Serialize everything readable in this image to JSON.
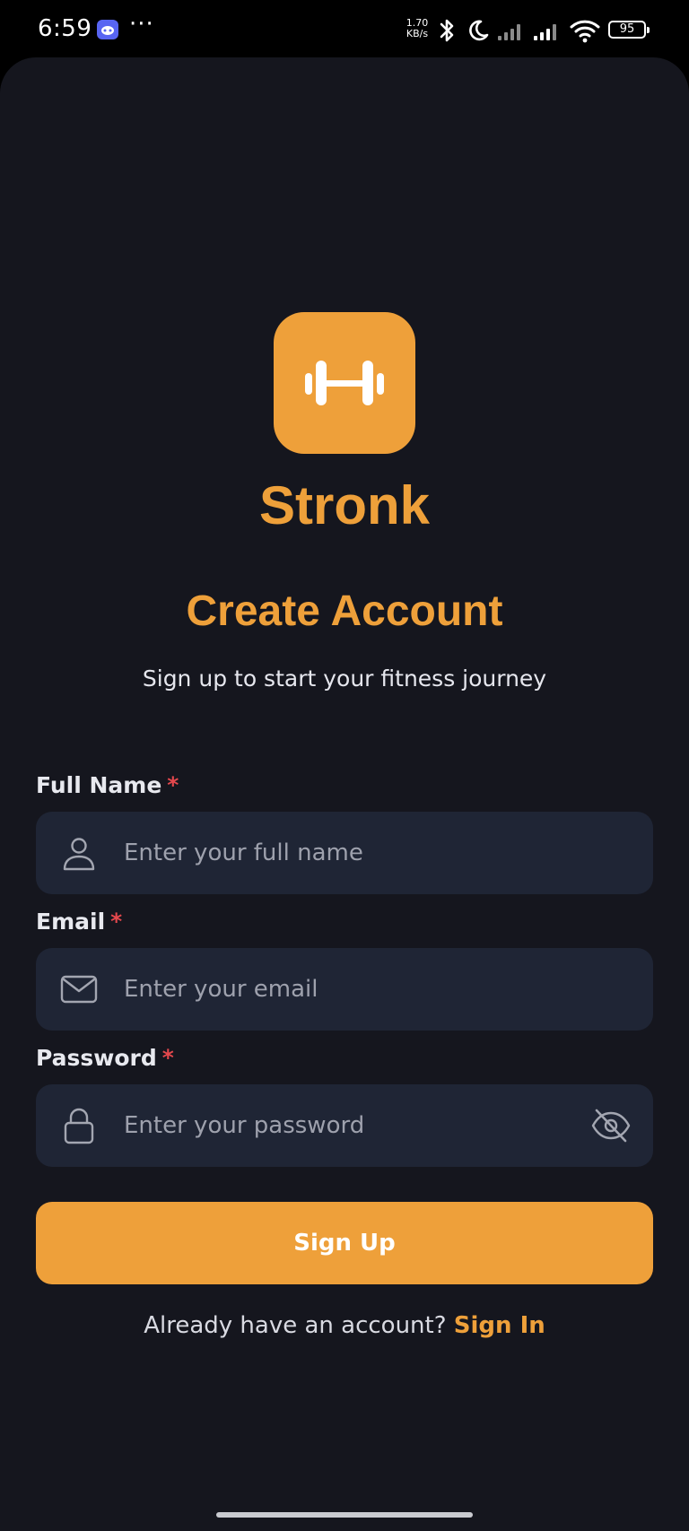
{
  "status_bar": {
    "time": "6:59",
    "notification_icons": [
      "discord-icon",
      "more-dots-icon"
    ],
    "more_dots": "···",
    "network_speed": "1.70",
    "network_speed_unit": "KB/s",
    "system_icons": [
      "bluetooth-icon",
      "do-not-disturb-moon-icon",
      "signal-icon",
      "signal-icon",
      "wifi-icon"
    ],
    "battery_level": "95"
  },
  "app": {
    "logo_icon": "dumbbell-icon",
    "brand_name": "Stronk",
    "title": "Create Account",
    "subtitle": "Sign up to start your fitness journey"
  },
  "form": {
    "required_marker": "*",
    "full_name": {
      "label": "Full Name",
      "placeholder": "Enter your full name",
      "value": "",
      "icon": "user-icon"
    },
    "email": {
      "label": "Email",
      "placeholder": "Enter your email",
      "value": "",
      "icon": "mail-icon"
    },
    "password": {
      "label": "Password",
      "placeholder": "Enter your password",
      "value": "",
      "icon": "lock-icon",
      "visibility_icon": "eye-off-icon"
    },
    "submit_label": "Sign Up"
  },
  "footer": {
    "prompt": "Already have an account?",
    "link_label": "Sign In"
  },
  "colors": {
    "accent": "#eea03a",
    "background": "#15161e",
    "input_background": "#1f2535",
    "required": "#e5484d"
  }
}
